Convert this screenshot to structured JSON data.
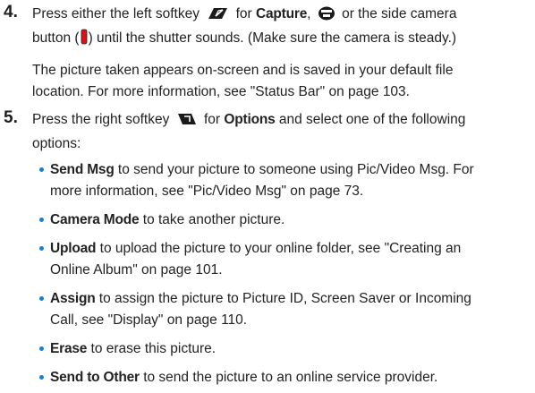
{
  "step4": {
    "number": "4.",
    "line1_a": "Press either the left softkey",
    "line1_b": "for",
    "line1_capture": "Capture",
    "line1_c": ",",
    "line1_d": "or the side camera",
    "line2_a": "button (",
    "line2_b": ") until the shutter sounds. (Make sure the camera is steady.)",
    "para_line1": "The picture taken appears on-screen and is saved in your default file",
    "para_line2": "location. For more information, see \"Status Bar\" on page 103."
  },
  "step5": {
    "number": "5.",
    "line1_a": "Press the right softkey",
    "line1_b": "for",
    "line1_options": "Options",
    "line1_c": "and select one of the following",
    "line2": "options:"
  },
  "options": [
    {
      "term": "Send Msg",
      "line1": " to send your picture to someone using Pic/Video Msg. For",
      "line2": "more information, see \"Pic/Video Msg\" on page 73."
    },
    {
      "term": "Camera Mode",
      "line1": " to take another picture.",
      "line2": ""
    },
    {
      "term": "Upload",
      "line1": " to upload the picture to your online folder, see \"Creating an",
      "line2": "Online Album\" on page 101."
    },
    {
      "term": "Assign",
      "line1": " to assign the picture to Picture ID, Screen Saver or Incoming",
      "line2": "Call, see \"Display\" on page 110."
    },
    {
      "term": "Erase",
      "line1": " to erase this picture.",
      "line2": ""
    },
    {
      "term": "Send to Other",
      "line1": " to send the picture to an online service provider.",
      "line2": ""
    }
  ],
  "icons": {
    "left_softkey": "left-softkey-icon",
    "menu_ok": "menu-ok-icon",
    "camera_button": "side-camera-button-icon",
    "right_softkey": "right-softkey-icon",
    "bullet_color": "#1e7ec8"
  }
}
